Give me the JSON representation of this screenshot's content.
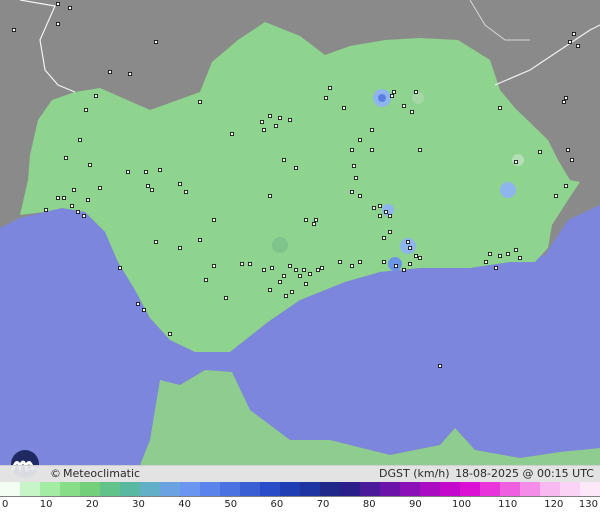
{
  "map": {
    "brand": "Meteoclimatic",
    "copyright_symbol": "©",
    "variable": "DGST (km/h)",
    "timestamp": "18-08-2025 @ 00:15 UTC",
    "colors": {
      "land_outside": "#8a8a8a",
      "sea": "#7b86dc",
      "region": "#8ed38e",
      "africa": "#8fcc8f",
      "station": "#000000",
      "gust_light": "#8fb5ee",
      "gust_blue": "#5a7fe0"
    },
    "scale": {
      "ticks": [
        "0",
        "10",
        "20",
        "30",
        "40",
        "50",
        "60",
        "70",
        "80",
        "90",
        "100",
        "110",
        "120",
        "130"
      ],
      "colors": [
        "#f2fff2",
        "#c8f5c8",
        "#a4eba4",
        "#88dd88",
        "#74cf7a",
        "#62c38a",
        "#58b8a0",
        "#62b0c8",
        "#6aa2e2",
        "#6a95f0",
        "#5a84ea",
        "#4a72e0",
        "#3a5fd4",
        "#2a4cc8",
        "#1f3eb4",
        "#1e34a0",
        "#20288a",
        "#2a1e8a",
        "#4a1a9a",
        "#6a14aa",
        "#8c10b8",
        "#aa0cc4",
        "#c408cc",
        "#da10d4",
        "#e834da",
        "#ef60e0",
        "#f48ce8",
        "#f8b8f0",
        "#fbd4f5",
        "#fde8fa"
      ]
    }
  }
}
